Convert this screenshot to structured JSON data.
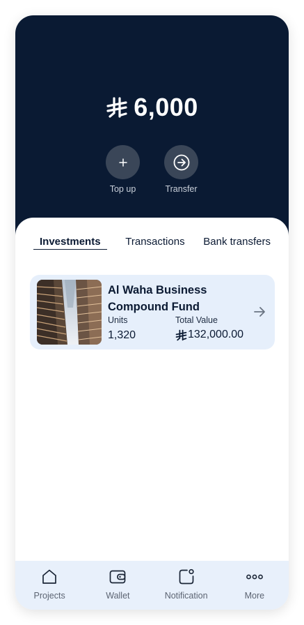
{
  "balance": {
    "currency_icon": "saudi-riyal-symbol",
    "value": "6,000"
  },
  "actions": [
    {
      "label": "Top up",
      "icon": "plus-icon"
    },
    {
      "label": "Transfer",
      "icon": "arrow-right-circle-icon"
    }
  ],
  "tabs": [
    {
      "label": "Investments",
      "active": true
    },
    {
      "label": "Transactions",
      "active": false
    },
    {
      "label": "Bank transfers",
      "active": false
    }
  ],
  "investment": {
    "name": "Al Waha Business Compound Fund",
    "units_label": "Units",
    "units_value": "1,320",
    "total_label": "Total Value",
    "total_value": "132,000.00",
    "image": "skyscrapers-photo"
  },
  "nav": [
    {
      "label": "Projects",
      "icon": "home-icon"
    },
    {
      "label": "Wallet",
      "icon": "wallet-icon"
    },
    {
      "label": "Notification",
      "icon": "notification-icon"
    },
    {
      "label": "More",
      "icon": "more-dots-icon"
    }
  ],
  "colors": {
    "hero_bg": "#0a1a33",
    "action_circle": "#3a4658",
    "card_bg": "#e6effb",
    "nav_bg": "#e8f0fb"
  }
}
